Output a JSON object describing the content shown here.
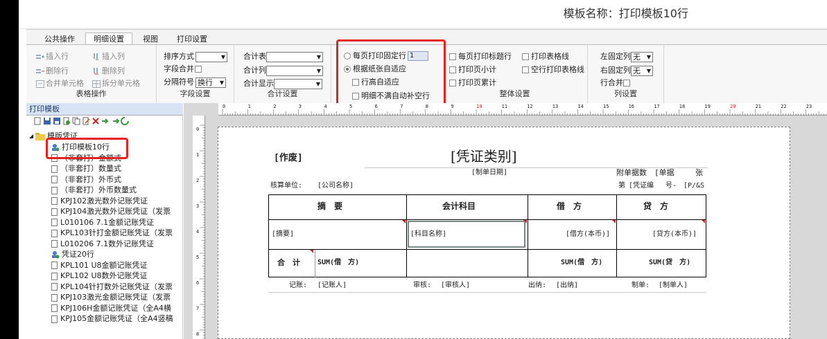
{
  "template_title": "模板名称：打印模板10行",
  "tabs": [
    "公共操作",
    "明细设置",
    "视图",
    "打印设置"
  ],
  "active_tab": "明细设置",
  "ribbon": {
    "table_ops": {
      "insert_row": "插入行",
      "insert_col": "插入列",
      "delete_row": "删除行",
      "delete_col": "删除列",
      "merge_cells": "合并单元格",
      "split_cells": "拆分单元格",
      "label": "表格操作"
    },
    "field_settings": {
      "sort_label": "排序方式",
      "field_merge_label": "字段合并",
      "separator_label": "分隔符号",
      "separator_value": "换行",
      "label": "字段设置"
    },
    "total_settings": {
      "total_table_label": "合计表",
      "total_col_label": "合计列",
      "total_display_label": "合计显示",
      "label": "合计设置"
    },
    "page_rows": {
      "fixed_rows_label": "每页打印固定行",
      "fixed_rows_value": "1",
      "paper_adaptive_label": "根据纸张自适应",
      "row_height_adaptive_label": "行高自适应",
      "auto_fill_label": "明细不满自动补空行"
    },
    "overall": {
      "print_title_label": "每页打印标题行",
      "print_subtotal_label": "打印页小计",
      "print_cumulative_label": "打印页累计",
      "print_grid_label": "打印表格线",
      "empty_row_grid_label": "空行打印表格线",
      "label": "整体设置"
    },
    "columns": {
      "left_fixed_label": "左固定列",
      "left_fixed_value": "无",
      "right_fixed_label": "右固定列",
      "right_fixed_value": "无",
      "row_merge_label": "行合并",
      "label": "列设置"
    }
  },
  "panel": {
    "title": "打印模板",
    "root": "模版凭证",
    "items": [
      "打印模板10行",
      "（非套打）金额式",
      "（非套打）数量式",
      "（非套打）外币式",
      "（非套打）外币数量式",
      "KPJ102激光数外记账凭证",
      "KPJ104激光数外记账凭证（发票",
      "L010106 7.1金额记账凭证",
      "KPL103针打金额记账凭证（发票",
      "L010206 7.1数外记账凭证",
      "凭证20行",
      "KPL101 U8金额记账凭证",
      "KPL102 U8数外记账凭证",
      "KPL104针打数外记账凭证（发票",
      "KPJ103激光金额记账凭证（发票",
      "KPJ106H金额记账凭证（全A4横",
      "KPJ105金额记账凭证（全A4竖稿"
    ]
  },
  "ruler": {
    "h": [
      "0",
      "1",
      "2",
      "3",
      "4",
      "5",
      "6",
      "7",
      "8",
      "9",
      "10",
      "11",
      "12",
      "13",
      "14",
      "15",
      "16",
      "17",
      "18",
      "19",
      "20",
      "21",
      "22",
      "23"
    ],
    "h_red": [
      "10",
      "20"
    ],
    "v": [
      "0",
      "1",
      "2",
      "3",
      "4",
      "5",
      "6",
      "7",
      "8"
    ]
  },
  "voucher": {
    "void_label": "[作废]",
    "type_label": "[凭证类别]",
    "date_label": "[制单日期]",
    "attach_label": "附单据数",
    "attach_value": "[单据",
    "sheet_label": "张",
    "unit_label": "核算单位:",
    "company": "[公司名称]",
    "page_prefix": "第",
    "voucher_no": "[凭证编",
    "no_label": "号-",
    "page_suffix": "[P/&S",
    "headers": [
      "摘　要",
      "会计科目",
      "借　方",
      "贷　方"
    ],
    "detail": [
      "[摘要]",
      "[科目名称]",
      "[借方(本币)]",
      "[贷方(本币)]"
    ],
    "total_label": "合　计",
    "sum_debit_a": "SUM(借　方)",
    "sum_debit_b": "SUM(借　方)",
    "sum_credit": "SUM(贷　方)",
    "bookkeeper_label": "记账:",
    "bookkeeper": "[记账人]",
    "reviewer_label": "审核:",
    "reviewer": "[审核人]",
    "cashier_label": "出纳:",
    "cashier": "[出纳]",
    "maker_label": "制单:",
    "maker": "[制单人]"
  }
}
